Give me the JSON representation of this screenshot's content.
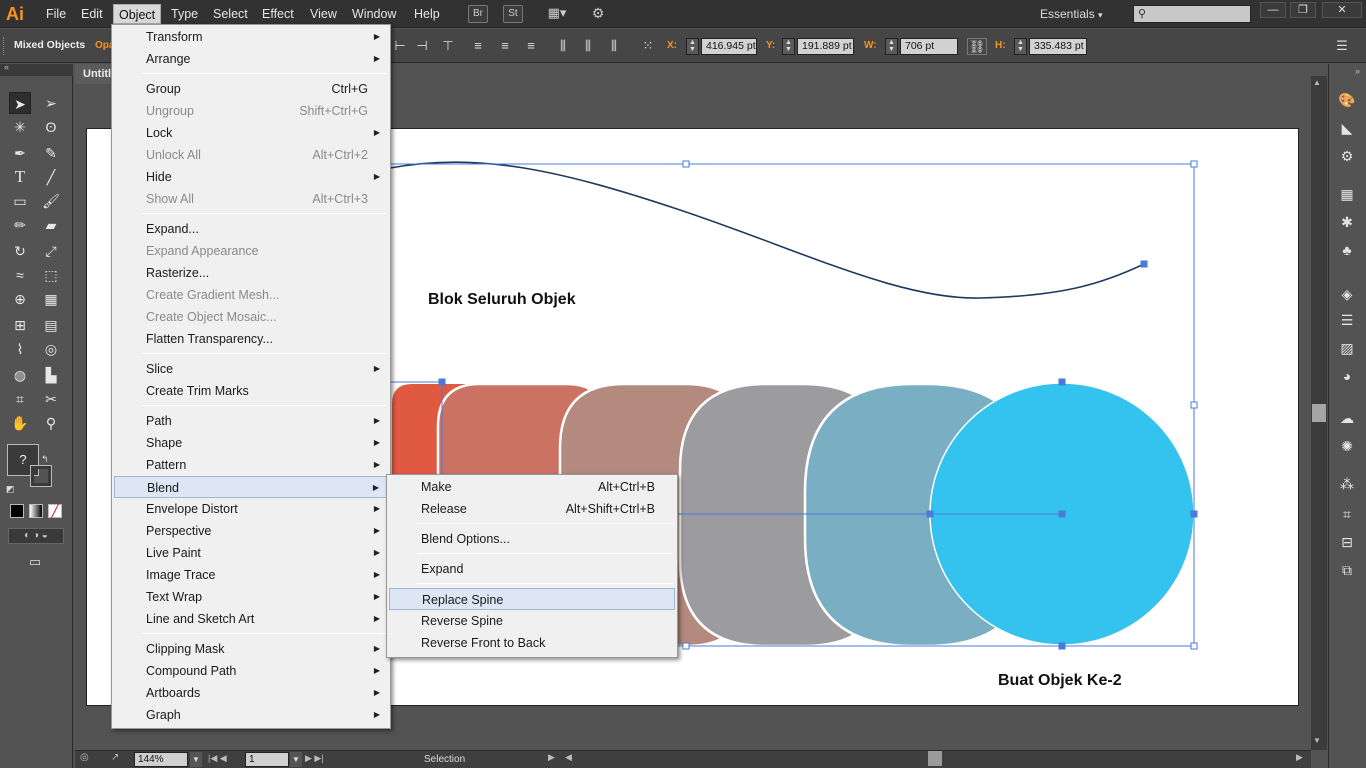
{
  "menubar": {
    "logo": "Ai",
    "items": [
      "File",
      "Edit",
      "Object",
      "Type",
      "Select",
      "Effect",
      "View",
      "Window",
      "Help"
    ],
    "buttons": [
      "Br",
      "St",
      "▦▾",
      "⚙"
    ],
    "workspace": "Essentials",
    "window_controls": [
      "—",
      "❐",
      "✕"
    ]
  },
  "control": {
    "selection_label": "Mixed Objects",
    "opacity_stub": "Opa",
    "x_label": "X:",
    "x_value": "416.945 pt",
    "y_label": "Y:",
    "y_value": "191.889 pt",
    "w_label": "W:",
    "w_value": "706 pt",
    "h_label": "H:",
    "h_value": "335.483 pt"
  },
  "document": {
    "tab_title": "Untitl",
    "text1": "Blok Seluruh Objek",
    "text2": "Buat Objek Ke-2",
    "colors": {
      "wave": "#1f3a5f",
      "blend_steps": [
        "#e05a42",
        "#cb7262",
        "#b4897e",
        "#9c9c9e",
        "#7aaec2",
        "#34c2ee"
      ],
      "selection": "#4a7bd9"
    }
  },
  "object_menu": {
    "groups": [
      [
        {
          "label": "Transform",
          "sub": true
        },
        {
          "label": "Arrange",
          "sub": true
        }
      ],
      [
        {
          "label": "Group",
          "sc": "Ctrl+G"
        },
        {
          "label": "Ungroup",
          "sc": "Shift+Ctrl+G",
          "disabled": true
        },
        {
          "label": "Lock",
          "sub": true
        },
        {
          "label": "Unlock All",
          "sc": "Alt+Ctrl+2",
          "disabled": true
        },
        {
          "label": "Hide",
          "sub": true
        },
        {
          "label": "Show All",
          "sc": "Alt+Ctrl+3",
          "disabled": true
        }
      ],
      [
        {
          "label": "Expand..."
        },
        {
          "label": "Expand Appearance",
          "disabled": true
        },
        {
          "label": "Rasterize..."
        },
        {
          "label": "Create Gradient Mesh...",
          "disabled": true
        },
        {
          "label": "Create Object Mosaic...",
          "disabled": true
        },
        {
          "label": "Flatten Transparency..."
        }
      ],
      [
        {
          "label": "Slice",
          "sub": true
        },
        {
          "label": "Create Trim Marks"
        }
      ],
      [
        {
          "label": "Path",
          "sub": true
        },
        {
          "label": "Shape",
          "sub": true
        },
        {
          "label": "Pattern",
          "sub": true
        },
        {
          "label": "Blend",
          "sub": true,
          "highlight": true
        },
        {
          "label": "Envelope Distort",
          "sub": true
        },
        {
          "label": "Perspective",
          "sub": true
        },
        {
          "label": "Live Paint",
          "sub": true
        },
        {
          "label": "Image Trace",
          "sub": true
        },
        {
          "label": "Text Wrap",
          "sub": true
        },
        {
          "label": "Line and Sketch Art",
          "sub": true
        }
      ],
      [
        {
          "label": "Clipping Mask",
          "sub": true
        },
        {
          "label": "Compound Path",
          "sub": true
        },
        {
          "label": "Artboards",
          "sub": true
        },
        {
          "label": "Graph",
          "sub": true
        }
      ]
    ]
  },
  "blend_menu": {
    "groups": [
      [
        {
          "label": "Make",
          "sc": "Alt+Ctrl+B"
        },
        {
          "label": "Release",
          "sc": "Alt+Shift+Ctrl+B"
        }
      ],
      [
        {
          "label": "Blend Options..."
        }
      ],
      [
        {
          "label": "Expand"
        }
      ],
      [
        {
          "label": "Replace Spine",
          "highlight": true
        },
        {
          "label": "Reverse Spine"
        },
        {
          "label": "Reverse Front to Back"
        }
      ]
    ]
  },
  "status": {
    "zoom": "144%",
    "artboard": "1",
    "tool": "Selection"
  }
}
